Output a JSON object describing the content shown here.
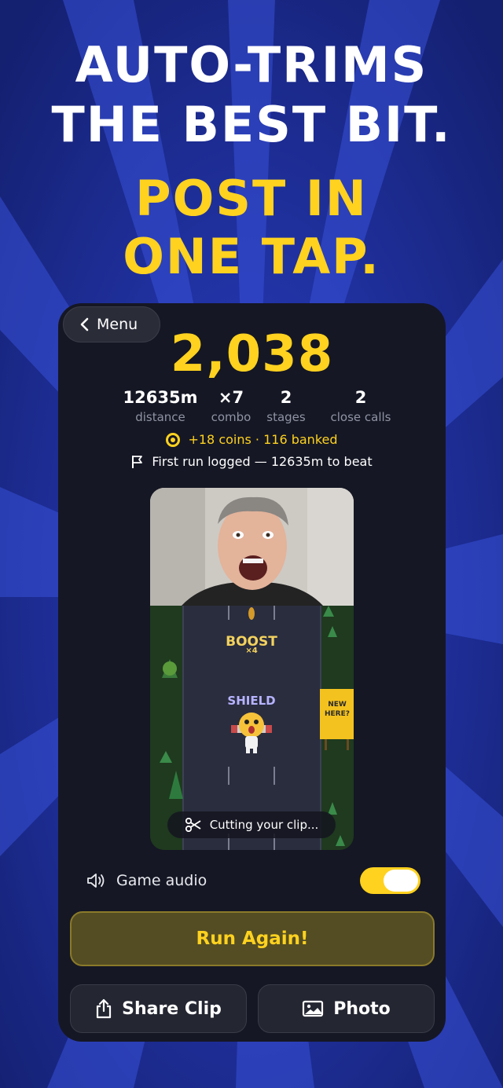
{
  "headline": {
    "line1": "AUTO-TRIMS",
    "line2": "THE BEST BIT.",
    "line3": "POST IN",
    "line4": "ONE TAP."
  },
  "colors": {
    "accent": "#ffd21f",
    "panel": "#151724",
    "background": "#1b2a8a"
  },
  "menu": {
    "label": "Menu"
  },
  "score": "2,038",
  "stats": [
    {
      "value": "12635m",
      "label": "distance"
    },
    {
      "value": "×7",
      "label": "combo"
    },
    {
      "value": "2",
      "label": "stages"
    },
    {
      "value": "2",
      "label": "close calls"
    }
  ],
  "coins": {
    "text": "+18 coins · 116 banked"
  },
  "logged": {
    "text": "First run logged — 12635m to beat"
  },
  "clip": {
    "boost_text": "BOOST",
    "boost_multiplier": "×4",
    "shield_text": "SHIELD",
    "sign_line1": "NEW",
    "sign_line2": "HERE?",
    "cutting_text": "Cutting your clip..."
  },
  "audio": {
    "label": "Game audio",
    "enabled": true
  },
  "buttons": {
    "run_again": "Run Again!",
    "share_clip": "Share Clip",
    "photo": "Photo"
  }
}
